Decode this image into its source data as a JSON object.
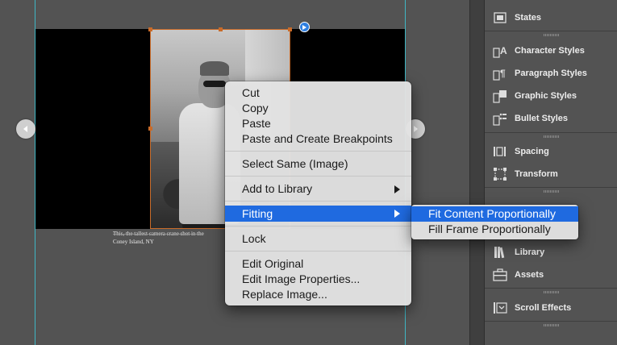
{
  "canvas": {
    "caption_line1": "This, the tallest camera crane shot in the",
    "caption_line2": "Coney Island, NY"
  },
  "panel": {
    "items": [
      {
        "label": "States",
        "icon": "states-icon"
      },
      {
        "label": "Character Styles",
        "icon": "character-styles-icon"
      },
      {
        "label": "Paragraph Styles",
        "icon": "paragraph-styles-icon"
      },
      {
        "label": "Graphic Styles",
        "icon": "graphic-styles-icon"
      },
      {
        "label": "Bullet Styles",
        "icon": "bullet-styles-icon"
      },
      {
        "label": "Spacing",
        "icon": "spacing-icon"
      },
      {
        "label": "Transform",
        "icon": "transform-icon"
      },
      {
        "label": "Library",
        "icon": "library-icon"
      },
      {
        "label": "Assets",
        "icon": "assets-icon"
      },
      {
        "label": "Scroll Effects",
        "icon": "scroll-effects-icon"
      }
    ]
  },
  "context_menu": {
    "cut": "Cut",
    "copy": "Copy",
    "paste": "Paste",
    "paste_breakpoints": "Paste and Create Breakpoints",
    "select_same": "Select Same (Image)",
    "add_to_library": "Add to Library",
    "fitting": "Fitting",
    "lock": "Lock",
    "edit_original": "Edit Original",
    "edit_image_properties": "Edit Image Properties...",
    "replace_image": "Replace Image...",
    "highlighted": "Fitting"
  },
  "submenu": {
    "fit_content": "Fit Content Proportionally",
    "fill_frame": "Fill Frame Proportionally",
    "highlighted": "Fit Content Proportionally"
  },
  "colors": {
    "selection": "#1f6ae0",
    "guide": "#3fb6c4",
    "frame": "#c96b29"
  }
}
